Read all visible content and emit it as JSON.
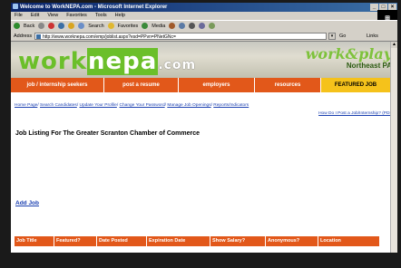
{
  "window": {
    "title": "Welcome to WorkNEPA.com - Microsoft Internet Explorer",
    "buttons": [
      "_",
      "□",
      "×"
    ]
  },
  "menu": [
    "File",
    "Edit",
    "View",
    "Favorites",
    "Tools",
    "Help"
  ],
  "toolbar": {
    "back": "Back",
    "search": "Search",
    "favorites": "Favorites",
    "media": "Media"
  },
  "address": {
    "label": "Address",
    "url": "http://www.worknepa.com/emp/joblist.aspx?esd=PPvn=PNetGNc=",
    "go": "Go",
    "links": "Links"
  },
  "banner": {
    "logo_work": "work",
    "logo_nepa": "nepa",
    "logo_dotcom": ".com",
    "tagline_main": "work&play",
    "tagline_sub": "Northeast PA"
  },
  "nav": [
    {
      "label": "job / internship seekers"
    },
    {
      "label": "post a resume"
    },
    {
      "label": "employers"
    },
    {
      "label": "resources"
    },
    {
      "label": "FEATURED JOB"
    }
  ],
  "links": [
    "Home Page",
    "Search Candidates",
    "Update Your Profile",
    "Change Your Password",
    "Manage Job Openings",
    "Reports/Indicators"
  ],
  "how_link": "How Do I Post a Job/Internship? (PDF)",
  "heading": "Job Listing For The Greater Scranton Chamber of Commerce",
  "add_job": "Add Job",
  "table_headers": [
    "Job Title",
    "Featured?",
    "Date Posted",
    "Expiration Date",
    "Show Salary?",
    "Anonymous?",
    "Location"
  ],
  "colors": {
    "nav_orange": "#e2581a",
    "featured_yellow": "#f5c21b",
    "logo_green": "#6bbf2a",
    "link_blue": "#1a3fb0"
  }
}
